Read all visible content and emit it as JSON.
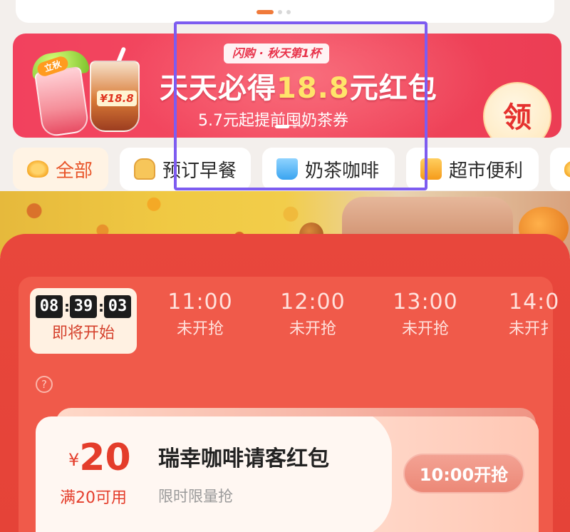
{
  "carousel_top": {
    "active_index": 0,
    "count": 3
  },
  "banner": {
    "tag": "闪购 · 秋天第1杯",
    "title_prefix": "天天必得",
    "title_amount": "18.8",
    "title_suffix": "元红包",
    "subtitle": "5.7元起提前囤奶茶券",
    "claim_label": "领",
    "cup_tag": "立秋",
    "cup_label": "¥18.8",
    "carousel": {
      "active_index": 0,
      "count": 3
    }
  },
  "tabs": [
    {
      "label": "全部",
      "icon": "all-icon",
      "active": true
    },
    {
      "label": "预订早餐",
      "icon": "bread-icon",
      "active": false
    },
    {
      "label": "奶茶咖啡",
      "icon": "drink-cup-icon",
      "active": false
    },
    {
      "label": "超市便利",
      "icon": "shopping-bag-icon",
      "active": false
    }
  ],
  "sale": {
    "current_slot": {
      "countdown": {
        "h": "08",
        "m": "39",
        "s": "03"
      },
      "status": "即将开始"
    },
    "slots": [
      {
        "time": "11:00",
        "status": "未开抢"
      },
      {
        "time": "12:00",
        "status": "未开抢"
      },
      {
        "time": "13:00",
        "status": "未开抢"
      },
      {
        "time": "14:0",
        "status": "未开扌"
      }
    ],
    "help_icon": "?"
  },
  "coupon": {
    "currency": "¥",
    "amount": "20",
    "condition": "满20可用",
    "title": "瑞幸咖啡请客红包",
    "subtitle": "限时限量抢",
    "button_label": "10:00开抢"
  },
  "colors": {
    "accent_red": "#e8473c",
    "banner_red": "#f2415e",
    "highlight": "#7d5cf0",
    "price_red": "#e43d2b",
    "amount_yellow": "#ffe46a"
  }
}
